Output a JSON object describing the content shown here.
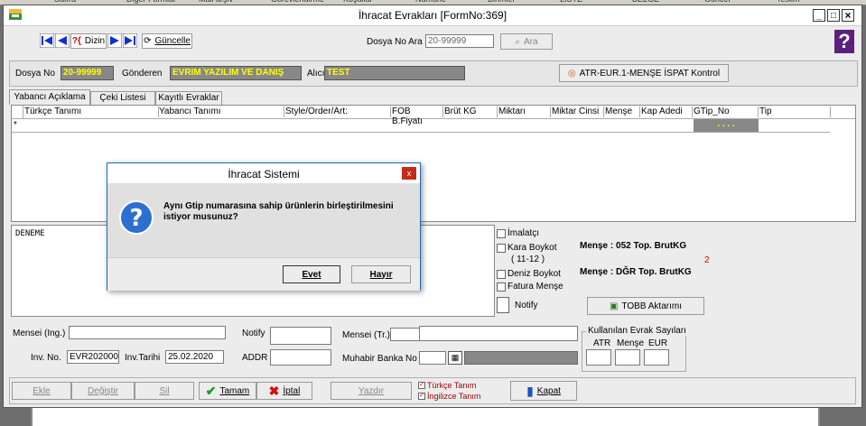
{
  "top_strip": {
    "items": [
      "Satıra",
      "Diğer Formlar",
      "Mail arşiv",
      "Görevlendirme",
      "Koşullar",
      "Numune",
      "Birimler",
      "LİSTE",
      "BELGE",
      "Güncel",
      "Teslim"
    ]
  },
  "window": {
    "title": "İhracat Evrakları [FormNo:369]",
    "min_label": "_",
    "max_label": "□",
    "close_label": "×"
  },
  "toolbar": {
    "dizin_label": "Dizin",
    "guncelle_label": "Güncelle",
    "dosya_no_ara_label": "Dosya No Ara",
    "search_value": "20-99999",
    "ara_label": "Ara",
    "help_label": "?"
  },
  "header": {
    "dosya_no_label": "Dosya No",
    "dosya_no_value": "20-99999",
    "gonderen_label": "Gönderen",
    "gonderen_value": "EVRIM YAZILIM VE DANIŞ",
    "alici_label": "Alıcı",
    "alici_value": "TEST",
    "atr_button_label": "ATR-EUR.1-MENŞE İSPAT Kontrol"
  },
  "tabs": [
    "Yabancı Açıklama",
    "Çeki Listesi",
    "Kayıtlı Evraklar"
  ],
  "grid": {
    "columns": [
      "Türkçe Tanımı",
      "Yabancı Tanımı",
      "Style/Order/Art:",
      "FOB B.Fiyatı",
      "Brüt KG",
      "Miktarı",
      "Miktar Cinsi",
      "Menşe",
      "Kap Adedi",
      "GTip_No",
      "Tip"
    ],
    "new_row_marker": "*",
    "gtip_placeholder": ". . . ."
  },
  "notes_text": "DENEME",
  "checkboxes": {
    "imalatci": "İmalatçı",
    "kara_boykot": "Kara Boykot",
    "kara_boykot_sub": "( 11-12 )",
    "deniz_boykot": "Deniz Boykot",
    "fatura_mense": "Fatura Menşe",
    "notify": "Notify"
  },
  "summary": {
    "line1": "Menşe : 052  Top. BrutKG",
    "count": "2",
    "line2": "Menşe : DĞR  Top. BrutKG",
    "tobb_label": "TOBB Aktarımı"
  },
  "form": {
    "mensei_ing_label": "Mensei (Ing.)",
    "notify_label": "Notify",
    "mensei_tr_label": "Mensei (Tr.)",
    "inv_no_label": "Inv. No.",
    "inv_no_value": "EVR202000",
    "inv_tarihi_label": "Inv.Tarihi",
    "inv_tarihi_value": "25.02.2020",
    "addr_label": "ADDR",
    "muhabir_label": "Muhabir Banka No",
    "kullanilan_label": "Kullanılan Evrak Sayıları",
    "atr_label": "ATR",
    "mense_label": "Menşe",
    "eur_label": "EUR"
  },
  "bottom_bar": {
    "ekle": "Ekle",
    "degistir": "Değiştir",
    "sil": "Sil",
    "tamam": "Tamam",
    "iptal": "İptal",
    "yazdir": "Yazdır",
    "turkce_tanim": "Türkçe Tanım",
    "ingilizce_tanim": "İngilizce Tanım",
    "kapat": "Kapat"
  },
  "dialog": {
    "title": "İhracat Sistemi",
    "close_label": "x",
    "message": "Aynı Gtip numarasına sahip ürünlerin birleştirilmesini istiyor musunuz?",
    "yes_label": "Evet",
    "no_label": "Hayır"
  }
}
